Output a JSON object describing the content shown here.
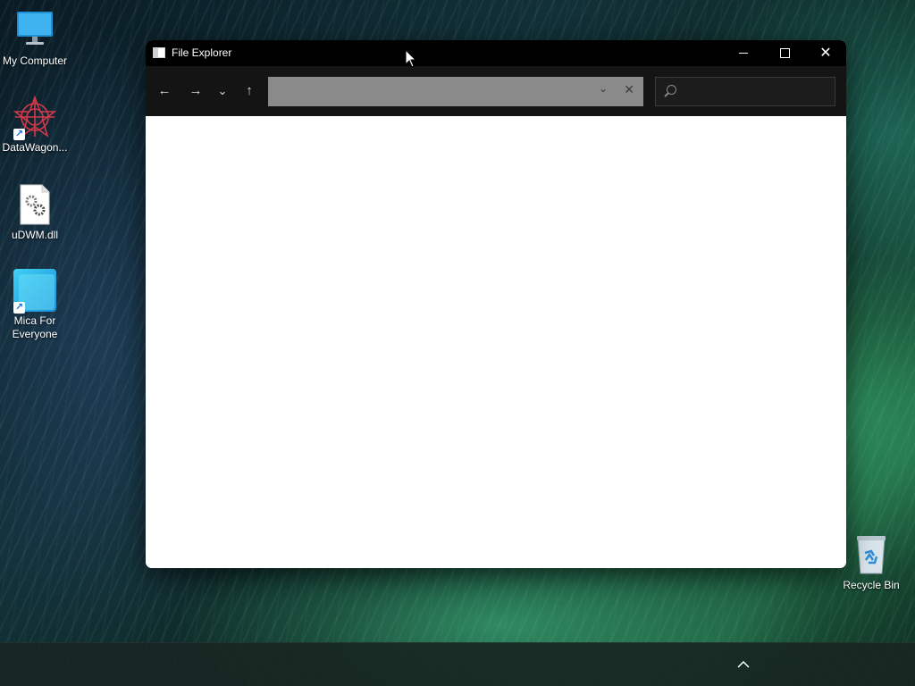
{
  "desktop": {
    "icons": [
      {
        "label": "My Computer",
        "icon": "monitor-icon"
      },
      {
        "label": "DataWagon...",
        "icon": "datawagon-icon"
      },
      {
        "label": "uDWM.dll",
        "icon": "dll-file-icon"
      },
      {
        "label": "Mica For\nEveryone",
        "icon": "mica-icon"
      },
      {
        "label": "Recycle Bin",
        "icon": "recycle-bin-icon"
      }
    ]
  },
  "window": {
    "title": "File Explorer",
    "controls": {
      "minimize": "minimize-icon",
      "maximize": "maximize-icon",
      "close": "close-icon"
    },
    "toolbar": {
      "back": "←",
      "forward": "→",
      "recent": "⌄",
      "up": "↑",
      "address_value": "",
      "address_dropdown": "⌄",
      "address_clear": "✕",
      "search_placeholder": ""
    }
  },
  "taskbar": {
    "tray_chevron": "^"
  },
  "colors": {
    "titlebar": "#000000",
    "toolbar": "#141414",
    "address_bg": "#8a8a8a",
    "content_bg": "#ffffff"
  }
}
